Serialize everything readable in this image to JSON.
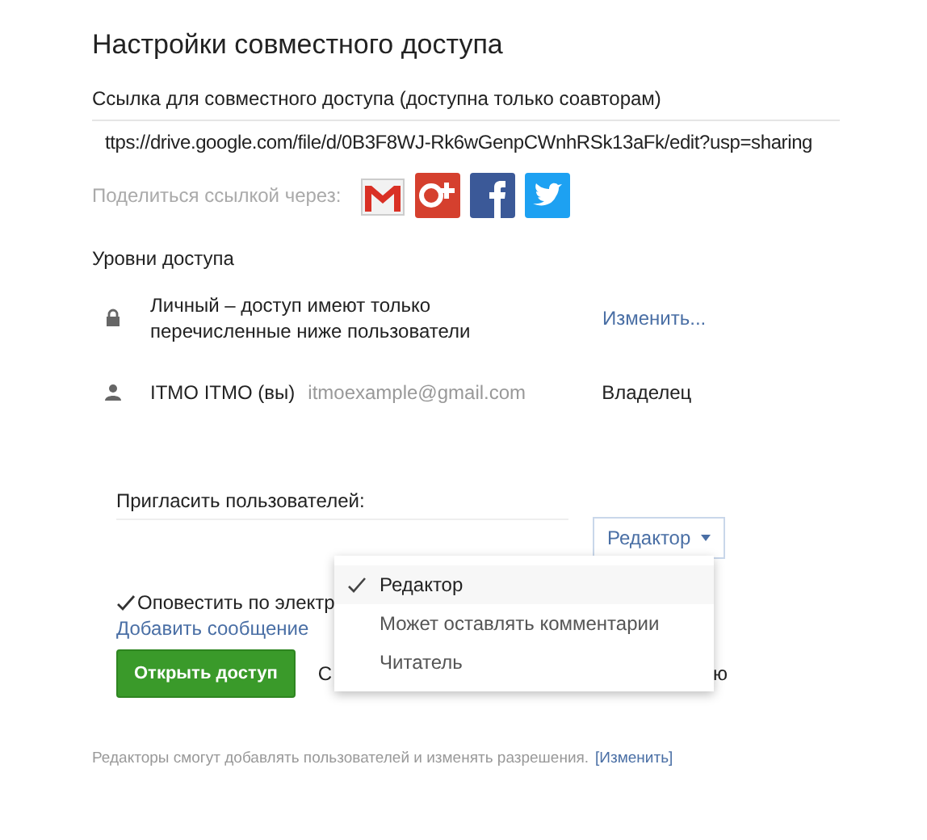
{
  "dialog": {
    "title": "Настройки совместного доступа"
  },
  "link": {
    "label": "Ссылка для совместного доступа (доступна только соавторам)",
    "url": "ttps://drive.google.com/file/d/0B3F8WJ-Rk6wGenpCWnhRSk13aFk/edit?usp=sharing"
  },
  "share": {
    "label": "Поделиться ссылкой через:",
    "services": [
      {
        "kind": "gmail"
      },
      {
        "kind": "gplus"
      },
      {
        "kind": "facebook"
      },
      {
        "kind": "twitter"
      }
    ]
  },
  "access": {
    "heading": "Уровни доступа",
    "rows": [
      {
        "kind": "visibility",
        "text": "Личный – доступ имеют только перечисленные ниже пользователи",
        "action": "Изменить..."
      },
      {
        "kind": "person",
        "name": "ITMO ITMO (вы)",
        "email": "itmoexample@gmail.com",
        "role": "Владелец"
      }
    ]
  },
  "invite": {
    "label": "Пригласить пользователей:",
    "role_button": "Редактор",
    "menu": [
      {
        "label": "Редактор",
        "selected": true
      },
      {
        "label": "Может оставлять комментарии",
        "selected": false
      },
      {
        "label": "Читатель",
        "selected": false
      }
    ],
    "notify": {
      "label": "Оповестить по электр",
      "checked": true
    },
    "add_message": "Добавить сообщение",
    "submit": "Открыть доступ",
    "fragment_1": "С",
    "fragment_2": "ю"
  },
  "footer": {
    "text": "Редакторы смогут добавлять пользователей и изменять разрешения.",
    "link": "[Изменить]"
  }
}
